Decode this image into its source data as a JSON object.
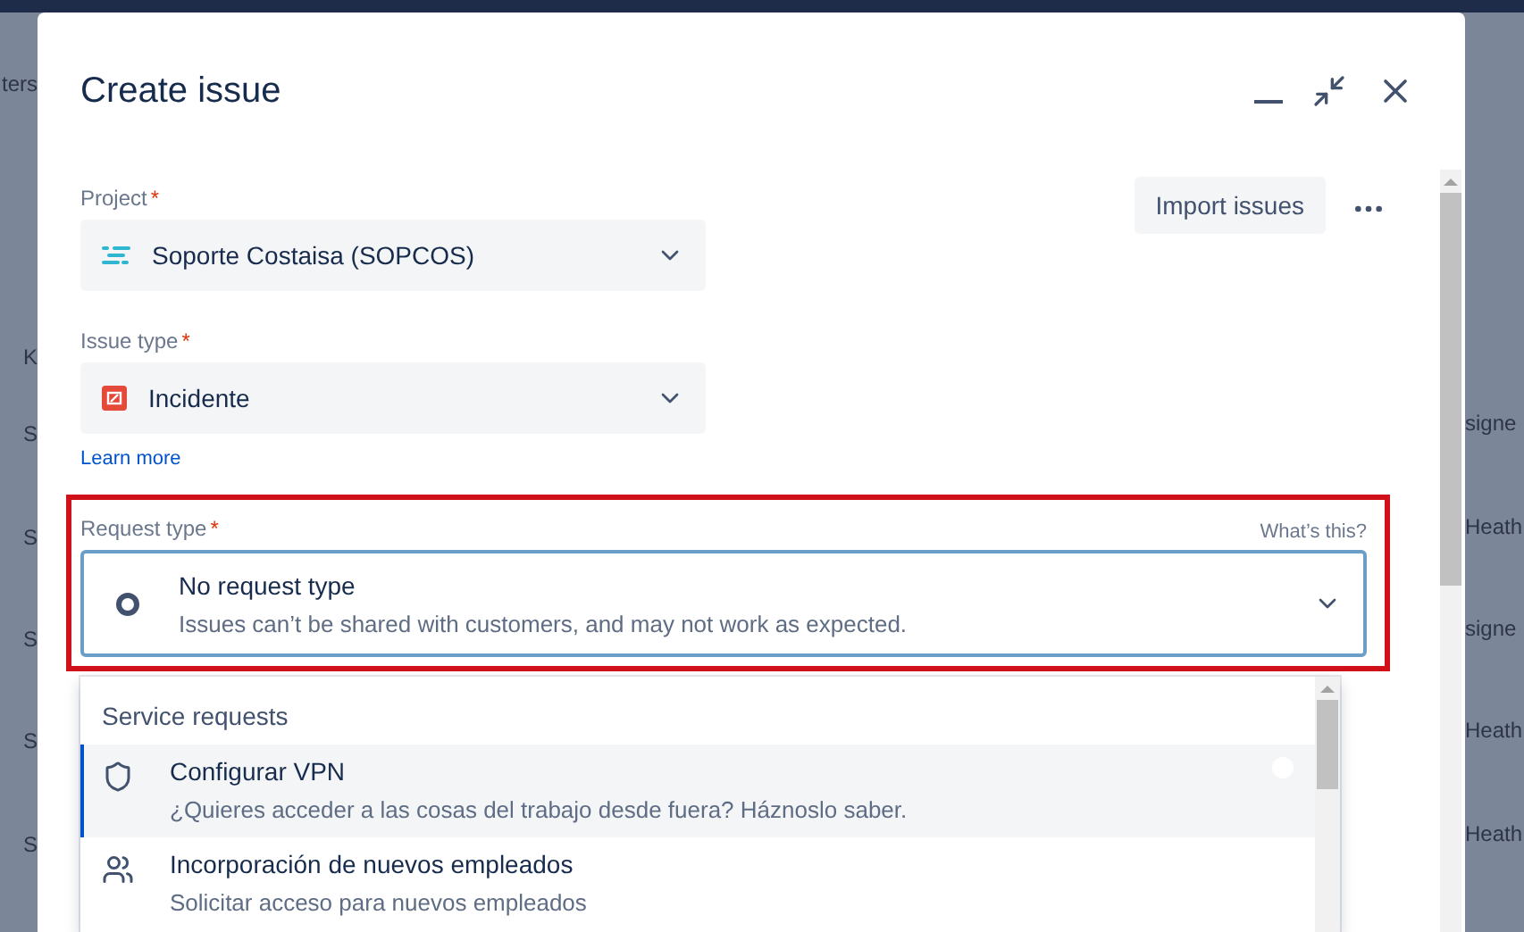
{
  "background": {
    "left_texts": [
      "ters",
      "K",
      "S",
      "S",
      "S",
      "S",
      "S"
    ],
    "right_texts": [
      "signe",
      "Heath",
      "signe",
      "Heath",
      "Heath"
    ]
  },
  "dialog": {
    "title": "Create issue",
    "import_button": "Import issues"
  },
  "project": {
    "label": "Project",
    "required_mark": "*",
    "value": "Soporte Costaisa (SOPCOS)"
  },
  "issue_type": {
    "label": "Issue type",
    "required_mark": "*",
    "value": "Incidente",
    "link": "Learn more"
  },
  "request_type": {
    "label": "Request type",
    "required_mark": "*",
    "hint": "What’s this?",
    "highlighted": true,
    "value": "No request type",
    "description": "Issues can’t be shared with customers, and may not work as expected.",
    "dropdown": {
      "group": "Service requests",
      "options": [
        {
          "kind": "shield",
          "title": "Configurar VPN",
          "description": "¿Quieres acceder a las cosas del trabajo desde fuera? Háznoslo saber.",
          "selected": true
        },
        {
          "kind": "people",
          "title": "Incorporación de nuevos empleados",
          "description": "Solicitar acceso para nuevos empleados",
          "selected": false
        }
      ]
    }
  }
}
